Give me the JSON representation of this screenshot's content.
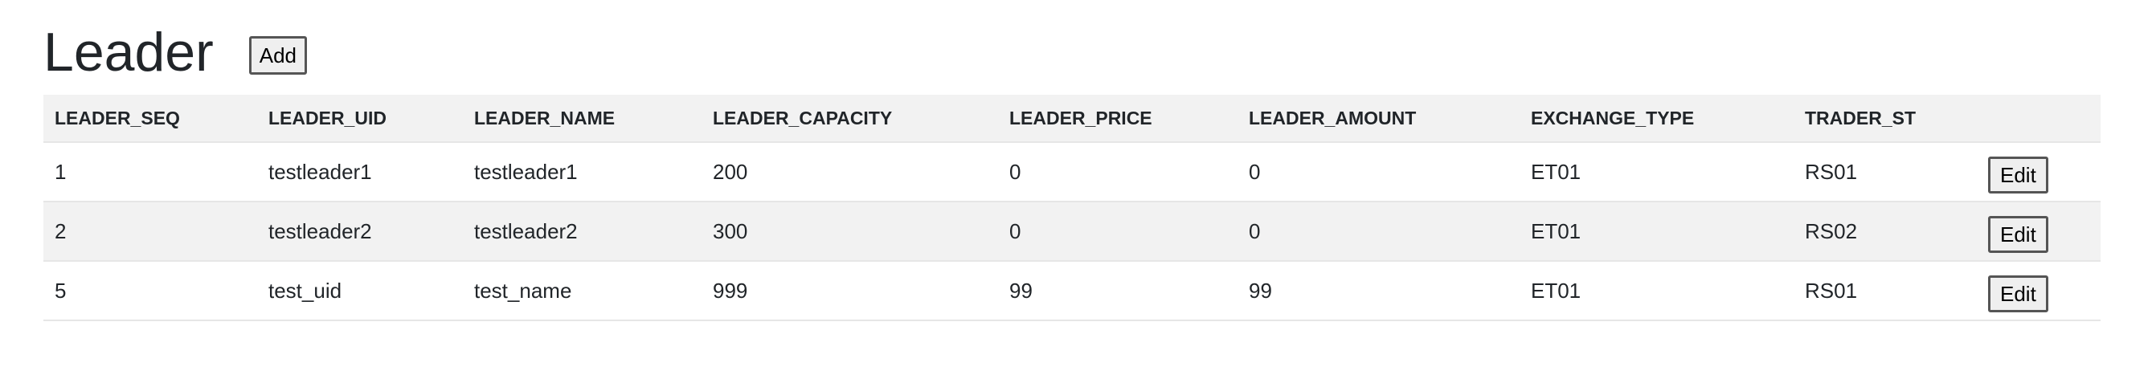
{
  "page": {
    "title": "Leader",
    "add_label": "Add"
  },
  "table": {
    "columns": [
      "LEADER_SEQ",
      "LEADER_UID",
      "LEADER_NAME",
      "LEADER_CAPACITY",
      "LEADER_PRICE",
      "LEADER_AMOUNT",
      "EXCHANGE_TYPE",
      "TRADER_ST",
      ""
    ],
    "rows": [
      {
        "seq": "1",
        "uid": "testleader1",
        "name": "testleader1",
        "capacity": "200",
        "price": "0",
        "amount": "0",
        "exchange_type": "ET01",
        "trader_st": "RS01",
        "edit_label": "Edit"
      },
      {
        "seq": "2",
        "uid": "testleader2",
        "name": "testleader2",
        "capacity": "300",
        "price": "0",
        "amount": "0",
        "exchange_type": "ET01",
        "trader_st": "RS02",
        "edit_label": "Edit"
      },
      {
        "seq": "5",
        "uid": "test_uid",
        "name": "test_name",
        "capacity": "999",
        "price": "99",
        "amount": "99",
        "exchange_type": "ET01",
        "trader_st": "RS01",
        "edit_label": "Edit"
      }
    ]
  },
  "colors": {
    "header_bg": "#f2f2f2",
    "stripe_bg": "#f2f2f2",
    "text": "#212529"
  }
}
